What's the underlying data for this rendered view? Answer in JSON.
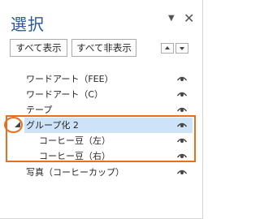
{
  "pane": {
    "title": "選択",
    "menu_icon": "dropdown-arrow-icon",
    "close_icon": "close-icon"
  },
  "toolbar": {
    "show_all_label": "すべて表示",
    "hide_all_label": "すべて非表示",
    "move_up_icon": "triangle-up-icon",
    "move_down_icon": "triangle-down-icon"
  },
  "items": [
    {
      "label": "ワードアート（FEE）",
      "visible": true
    },
    {
      "label": "ワードアート（C）",
      "visible": true
    },
    {
      "label": "テープ",
      "visible": true
    },
    {
      "label": "グループ化 2",
      "visible": true,
      "selected": true,
      "expanded": true
    },
    {
      "label": "コーヒー豆（左）",
      "visible": true,
      "indent": 1
    },
    {
      "label": "コーヒー豆（右）",
      "visible": true,
      "indent": 1
    },
    {
      "label": "写真（コーヒーカップ）",
      "visible": true
    }
  ],
  "colors": {
    "title": "#2b579a",
    "selection": "#cde3f7",
    "highlight": "#e96f20"
  }
}
